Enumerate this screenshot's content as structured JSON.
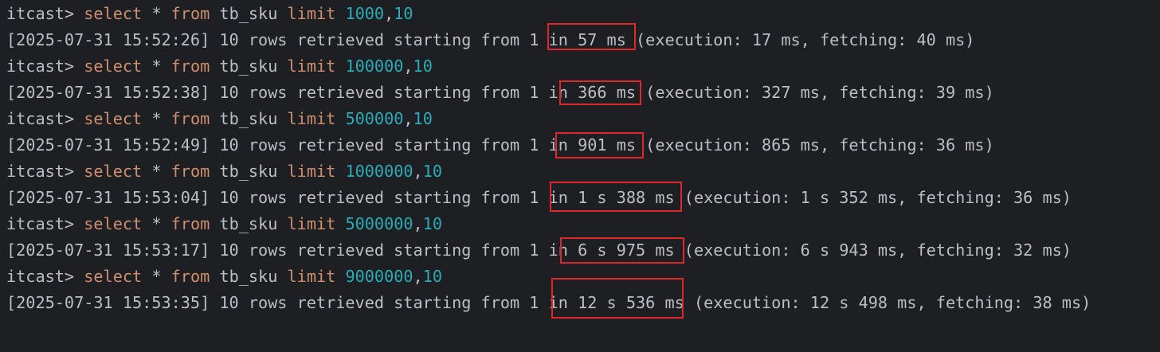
{
  "colors": {
    "background": "#1e1f22",
    "text": "#bcbec4",
    "keyword": "#cf8e6d",
    "number": "#2aacb8",
    "highlight_box": "#e0272c"
  },
  "keywords": {
    "select": "select",
    "from": "from",
    "limit": "limit"
  },
  "entries": [
    {
      "prompt": "itcast>",
      "star": "*",
      "table": "tb_sku",
      "offset": "1000",
      "comma": ",",
      "count": "10",
      "result_prefix": "[2025-07-31 15:52:26] 10 rows retrieved starting from 1 in ",
      "total_time": "57 ms",
      "result_suffix": " (execution: 17 ms, fetching: 40 ms)"
    },
    {
      "prompt": "itcast>",
      "star": "*",
      "table": "tb_sku",
      "offset": "100000",
      "comma": ",",
      "count": "10",
      "result_prefix": "[2025-07-31 15:52:38] 10 rows retrieved starting from 1 in ",
      "total_time": "366 ms",
      "result_suffix": " (execution: 327 ms, fetching: 39 ms)"
    },
    {
      "prompt": "itcast>",
      "star": "*",
      "table": "tb_sku",
      "offset": "500000",
      "comma": ",",
      "count": "10",
      "result_prefix": "[2025-07-31 15:52:49] 10 rows retrieved starting from 1 in ",
      "total_time": "901 ms",
      "result_suffix": " (execution: 865 ms, fetching: 36 ms)"
    },
    {
      "prompt": "itcast>",
      "star": "*",
      "table": "tb_sku",
      "offset": "1000000",
      "comma": ",",
      "count": "10",
      "result_prefix": "[2025-07-31 15:53:04] 10 rows retrieved starting from 1 in ",
      "total_time": "1 s 388 ms",
      "result_suffix": " (execution: 1 s 352 ms, fetching: 36 ms)"
    },
    {
      "prompt": "itcast>",
      "star": "*",
      "table": "tb_sku",
      "offset": "5000000",
      "comma": ",",
      "count": "10",
      "result_prefix": "[2025-07-31 15:53:17] 10 rows retrieved starting from 1 in ",
      "total_time": "6 s 975 ms",
      "result_suffix": " (execution: 6 s 943 ms, fetching: 32 ms)"
    },
    {
      "prompt": "itcast>",
      "star": "*",
      "table": "tb_sku",
      "offset": "9000000",
      "comma": ",",
      "count": "10",
      "result_prefix": "[2025-07-31 15:53:35] 10 rows retrieved starting from 1 in ",
      "total_time": "12 s 536 ms",
      "result_suffix": " (execution: 12 s 498 ms, fetching: 38 ms)"
    }
  ]
}
